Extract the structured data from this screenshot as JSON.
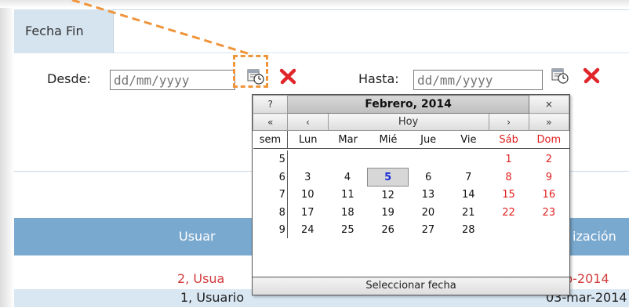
{
  "filter": {
    "legend": "Fecha Fin",
    "desde_label": "Desde:",
    "hasta_label": "Hasta:",
    "desde_placeholder": "dd/mm/yyyy",
    "hasta_placeholder": "dd/mm/yyyy"
  },
  "calendar": {
    "help": "?",
    "title": "Febrero, 2014",
    "close": "×",
    "prev_year": "«",
    "prev_month": "‹",
    "today": "Hoy",
    "next_month": "›",
    "next_year": "»",
    "week_label": "sem",
    "day_names": [
      "Lun",
      "Mar",
      "Mié",
      "Jue",
      "Vie",
      "Sáb",
      "Dom"
    ],
    "weeks": [
      {
        "num": "5",
        "days": [
          "",
          "",
          "",
          "",
          "",
          "1",
          "2"
        ]
      },
      {
        "num": "6",
        "days": [
          "3",
          "4",
          "5",
          "6",
          "7",
          "8",
          "9"
        ]
      },
      {
        "num": "7",
        "days": [
          "10",
          "11",
          "12",
          "13",
          "14",
          "15",
          "16"
        ]
      },
      {
        "num": "8",
        "days": [
          "17",
          "18",
          "19",
          "20",
          "21",
          "22",
          "23"
        ]
      },
      {
        "num": "9",
        "days": [
          "24",
          "25",
          "26",
          "27",
          "28",
          "",
          ""
        ]
      }
    ],
    "footer": "Seleccionar fecha"
  },
  "table": {
    "header_left": "Usuar",
    "header_right": "ización",
    "rows": [
      {
        "left": "2, Usua",
        "right": "b-2014"
      },
      {
        "left": "1, Usuario",
        "right": "03-mar-2014"
      }
    ]
  },
  "colors": {
    "accent_dash": "#f0943a",
    "header_bg": "#7aa9cf",
    "weekend": "#e02020",
    "today": "#1a2fd8"
  }
}
